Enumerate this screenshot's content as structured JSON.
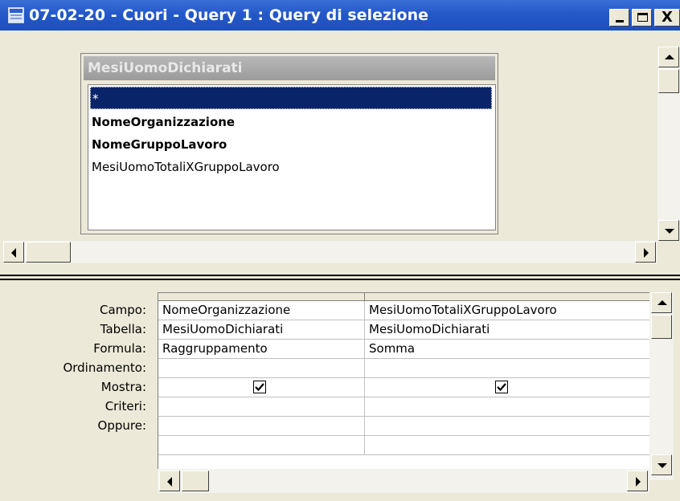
{
  "window": {
    "title": "07-02-20 - Cuori - Query 1 : Query di selezione",
    "icon": "query-design-icon",
    "controls": [
      "minimize-icon",
      "maximize-icon",
      "close-icon"
    ],
    "close_glyph": "X"
  },
  "field_list": {
    "title": "MesiUomoDichiarati",
    "items": [
      {
        "label": "*",
        "selected": true,
        "bold": false
      },
      {
        "label": "NomeOrganizzazione",
        "selected": false,
        "bold": true
      },
      {
        "label": "NomeGruppoLavoro",
        "selected": false,
        "bold": true
      },
      {
        "label": "MesiUomoTotaliXGruppoLavoro",
        "selected": false,
        "bold": false
      }
    ]
  },
  "design_grid": {
    "row_labels": [
      "Campo:",
      "Tabella:",
      "Formula:",
      "Ordinamento:",
      "Mostra:",
      "Criteri:",
      "Oppure:"
    ],
    "columns": [
      {
        "campo": "NomeOrganizzazione",
        "tabella": "MesiUomoDichiarati",
        "formula": "Raggruppamento",
        "ordinamento": "",
        "mostra": true,
        "criteri": "",
        "oppure": ""
      },
      {
        "campo": "MesiUomoTotaliXGruppoLavoro",
        "tabella": "MesiUomoDichiarati",
        "formula": "Somma",
        "ordinamento": "",
        "mostra": true,
        "criteri": "",
        "oppure": ""
      }
    ]
  },
  "colors": {
    "titlebar": "#2458c8",
    "selection": "#0a246a",
    "face": "#ece9d8"
  }
}
